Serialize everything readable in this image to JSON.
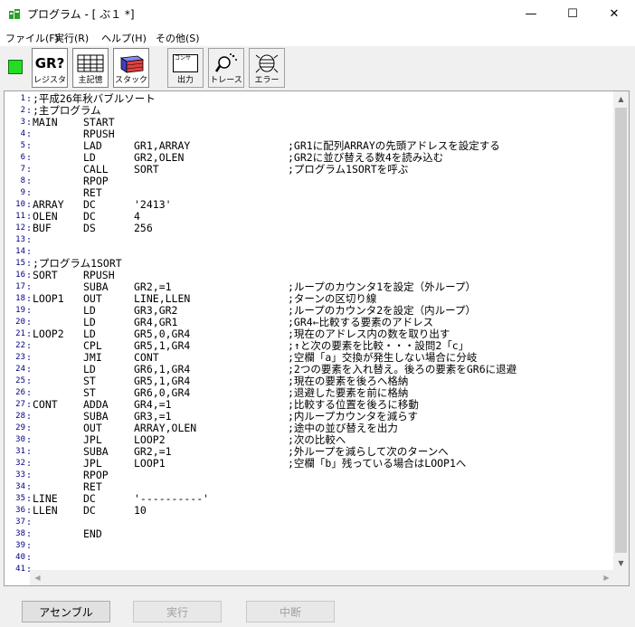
{
  "window": {
    "title": "プログラム - [ ぶ１ *]",
    "min_symbol": "—",
    "max_symbol": "☐",
    "close_symbol": "✕"
  },
  "menu": [
    {
      "label": "ファイル(F)"
    },
    {
      "label": "実行(R)"
    },
    {
      "label": "ヘルプ(H)"
    },
    {
      "label": "その他(S)"
    }
  ],
  "toolbar": {
    "status_color": "#22dd22",
    "buttons": [
      {
        "label": "レジスタ",
        "icon": "gr-icon",
        "icon_text": "GR?"
      },
      {
        "label": "主記憶",
        "icon": "memory-grid-icon"
      },
      {
        "label": "スタック",
        "icon": "stack-icon"
      },
      {
        "label": "出力",
        "icon": "console-icon",
        "icon_text": "コンサ"
      },
      {
        "label": "トレース",
        "icon": "trace-icon"
      },
      {
        "label": "エラー",
        "icon": "bug-icon"
      }
    ]
  },
  "editor": {
    "line_numbers": [
      "1",
      "2",
      "3",
      "4",
      "5",
      "6",
      "7",
      "8",
      "9",
      "10",
      "11",
      "12",
      "13",
      "14",
      "15",
      "16",
      "17",
      "18",
      "19",
      "20",
      "21",
      "22",
      "23",
      "24",
      "25",
      "26",
      "27",
      "28",
      "29",
      "30",
      "31",
      "32",
      "33",
      "34",
      "35",
      "36",
      "37",
      "38",
      "39",
      "40",
      "41"
    ],
    "lines": [
      {
        "label": ";平成26年秋バブルソート",
        "op": "",
        "operand": "",
        "comment": ""
      },
      {
        "label": ";主プログラム",
        "op": "",
        "operand": "",
        "comment": ""
      },
      {
        "label": "MAIN",
        "op": "START",
        "operand": "",
        "comment": ""
      },
      {
        "label": "",
        "op": "RPUSH",
        "operand": "",
        "comment": ""
      },
      {
        "label": "",
        "op": "LAD",
        "operand": "GR1,ARRAY",
        "comment": ";GR1に配列ARRAYの先頭アドレスを設定する"
      },
      {
        "label": "",
        "op": "LD",
        "operand": "GR2,OLEN",
        "comment": ";GR2に並び替える数4を読み込む"
      },
      {
        "label": "",
        "op": "CALL",
        "operand": "SORT",
        "comment": ";プログラム1SORTを呼ぶ"
      },
      {
        "label": "",
        "op": "RPOP",
        "operand": "",
        "comment": ""
      },
      {
        "label": "",
        "op": "RET",
        "operand": "",
        "comment": ""
      },
      {
        "label": "ARRAY",
        "op": "DC",
        "operand": "'2413'",
        "comment": ""
      },
      {
        "label": "OLEN",
        "op": "DC",
        "operand": "4",
        "comment": ""
      },
      {
        "label": "BUF",
        "op": "DS",
        "operand": "256",
        "comment": ""
      },
      {
        "label": "",
        "op": "",
        "operand": "",
        "comment": ""
      },
      {
        "label": "",
        "op": "",
        "operand": "",
        "comment": ""
      },
      {
        "label": ";プログラム1SORT",
        "op": "",
        "operand": "",
        "comment": ""
      },
      {
        "label": "SORT",
        "op": "RPUSH",
        "operand": "",
        "comment": ""
      },
      {
        "label": "",
        "op": "SUBA",
        "operand": "GR2,=1",
        "comment": ";ループのカウンタ1を設定（外ループ）"
      },
      {
        "label": "LOOP1",
        "op": "OUT",
        "operand": "LINE,LLEN",
        "comment": ";ターンの区切り線"
      },
      {
        "label": "",
        "op": "LD",
        "operand": "GR3,GR2",
        "comment": ";ループのカウンタ2を設定（内ループ）"
      },
      {
        "label": "",
        "op": "LD",
        "operand": "GR4,GR1",
        "comment": ";GR4←比較する要素のアドレス"
      },
      {
        "label": "LOOP2",
        "op": "LD",
        "operand": "GR5,0,GR4",
        "comment": ";現在のアドレス内の数を取り出す"
      },
      {
        "label": "",
        "op": "CPL",
        "operand": "GR5,1,GR4",
        "comment": ";↑と次の要素を比較・・・設問2「c」"
      },
      {
        "label": "",
        "op": "JMI",
        "operand": "CONT",
        "comment": ";空欄「a」交換が発生しない場合に分岐"
      },
      {
        "label": "",
        "op": "LD",
        "operand": "GR6,1,GR4",
        "comment": ";2つの要素を入れ替え。後ろの要素をGR6に退避"
      },
      {
        "label": "",
        "op": "ST",
        "operand": "GR5,1,GR4",
        "comment": ";現在の要素を後ろへ格納"
      },
      {
        "label": "",
        "op": "ST",
        "operand": "GR6,0,GR4",
        "comment": ";退避した要素を前に格納"
      },
      {
        "label": "CONT",
        "op": "ADDA",
        "operand": "GR4,=1",
        "comment": ";比較する位置を後ろに移動"
      },
      {
        "label": "",
        "op": "SUBA",
        "operand": "GR3,=1",
        "comment": ";内ループカウンタを減らす"
      },
      {
        "label": "",
        "op": "OUT",
        "operand": "ARRAY,OLEN",
        "comment": ";途中の並び替えを出力"
      },
      {
        "label": "",
        "op": "JPL",
        "operand": "LOOP2",
        "comment": ";次の比較へ"
      },
      {
        "label": "",
        "op": "SUBA",
        "operand": "GR2,=1",
        "comment": ";外ループを減らして次のターンへ"
      },
      {
        "label": "",
        "op": "JPL",
        "operand": "LOOP1",
        "comment": ";空欄「b」残っている場合はLOOP1へ"
      },
      {
        "label": "",
        "op": "RPOP",
        "operand": "",
        "comment": ""
      },
      {
        "label": "",
        "op": "RET",
        "operand": "",
        "comment": ""
      },
      {
        "label": "LINE",
        "op": "DC",
        "operand": "'----------'",
        "comment": ""
      },
      {
        "label": "LLEN",
        "op": "DC",
        "operand": "10",
        "comment": ""
      },
      {
        "label": "",
        "op": "",
        "operand": "",
        "comment": ""
      },
      {
        "label": "",
        "op": "END",
        "operand": "",
        "comment": ""
      },
      {
        "label": "",
        "op": "",
        "operand": "",
        "comment": ""
      },
      {
        "label": "",
        "op": "",
        "operand": "",
        "comment": ""
      },
      {
        "label": "",
        "op": "",
        "operand": "",
        "comment": ""
      }
    ]
  },
  "buttons": {
    "assemble": "アセンブル",
    "run": "実行",
    "stop": "中断"
  }
}
